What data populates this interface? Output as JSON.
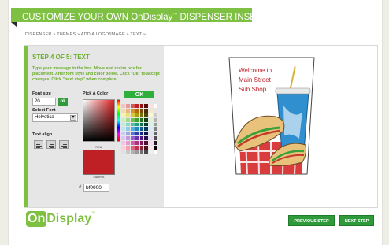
{
  "header": {
    "banner_prefix": "CUSTOMIZE YOUR OWN OnDisplay",
    "banner_tm": "™",
    "banner_suffix": " DISPENSER INSERTS"
  },
  "breadcrumb": {
    "text": "DISPENSER » THEMES » ADD A LOGO/IMAGE » TEXT »"
  },
  "editor": {
    "step_title": "STEP 4 OF 5: TEXT",
    "instructions": "Type your message in the box. Move and resize box for placement. After font style and color below. Click \"Ok\" to accept changes. Click \"next step\" when complete.",
    "font_size_label": "Font size",
    "font_size_value": "20",
    "font_size_ok": "ok",
    "select_font_label": "Select Font",
    "select_font_value": "Helvetica",
    "text_align_label": "Text align",
    "pick_color_label": "Pick A Color",
    "ok_label": "OK",
    "new_label": "new",
    "current_label": "current",
    "hash": "#",
    "hex_value": "bf0000",
    "current_color": "#bf2026"
  },
  "preview": {
    "line1": "Welcome to",
    "line2": "Main Street",
    "line3": "Sub Shop",
    "text_color": "#bf2026"
  },
  "footer": {
    "logo_on": "On",
    "logo_display": "Display",
    "logo_tm": "™",
    "prev_label": "PREVIOUS STEP",
    "next_label": "NEXT STEP"
  },
  "colors": {
    "brand_green": "#7ec142",
    "button_green": "#2e9a3a"
  }
}
